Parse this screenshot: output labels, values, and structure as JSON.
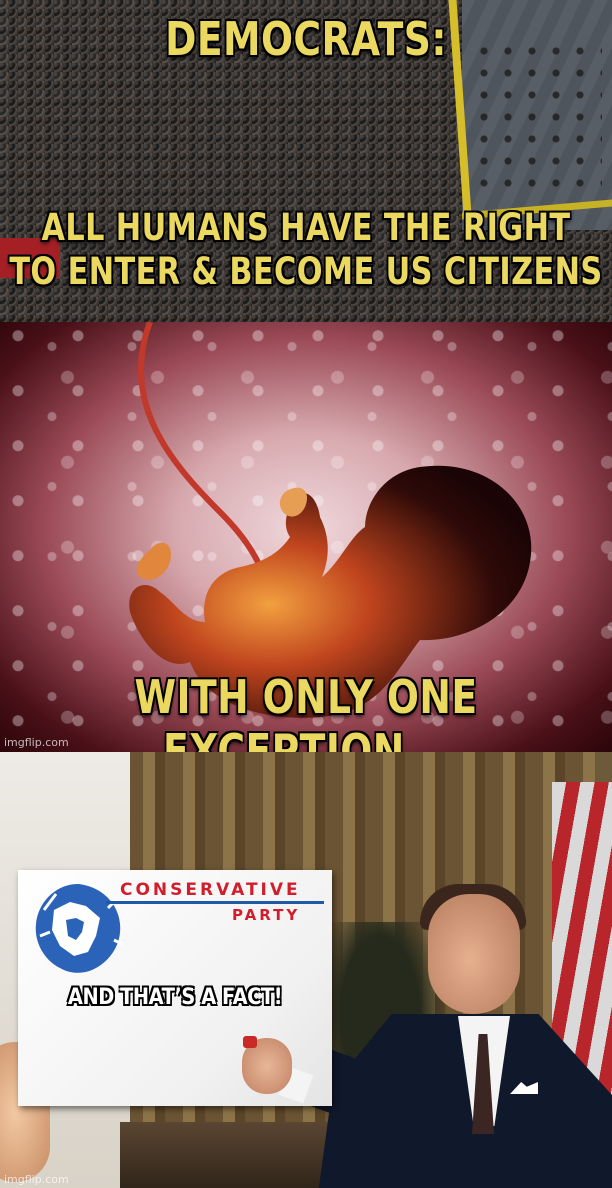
{
  "panel_top": {
    "title": "DEMOCRATS:",
    "caption": "ALL HUMANS HAVE THE RIGHT\nTO ENTER & BECOME US CITIZENS"
  },
  "panel_middle": {
    "caption": "WITH ONLY ONE EXCEPTION...",
    "watermark": "imgflip.com"
  },
  "panel_bottom": {
    "sign": {
      "brand_line1": "CONSERVATIVE",
      "brand_line2": "PARTY",
      "message": "AND THAT’S A FACT!"
    },
    "watermark": "imgflip.com"
  },
  "colors": {
    "caption_yellow": "#ead860",
    "brand_red": "#d11e2c",
    "brand_blue": "#1f5aa8"
  }
}
